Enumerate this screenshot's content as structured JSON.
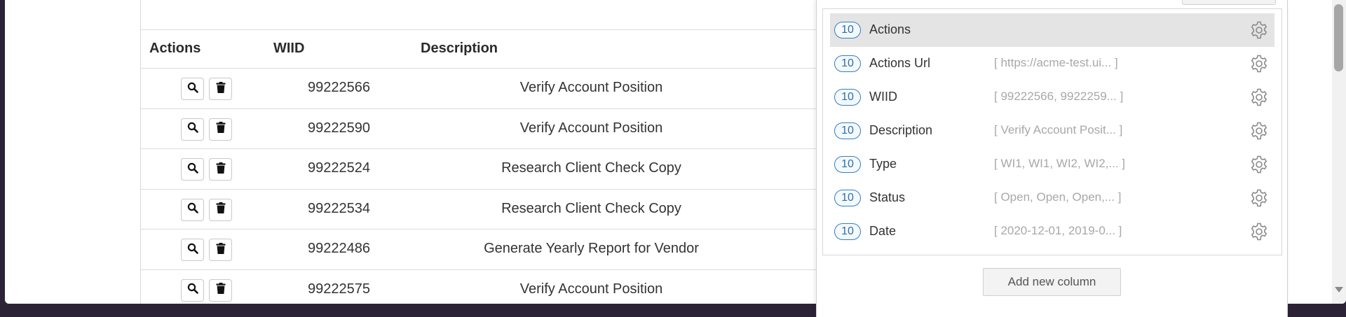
{
  "table": {
    "headers": {
      "actions": "Actions",
      "wiid": "WIID",
      "description": "Description"
    },
    "rows": [
      {
        "wiid": "99222566",
        "description": "Verify Account Position"
      },
      {
        "wiid": "99222590",
        "description": "Verify Account Position"
      },
      {
        "wiid": "99222524",
        "description": "Research Client Check Copy"
      },
      {
        "wiid": "99222534",
        "description": "Research Client Check Copy"
      },
      {
        "wiid": "99222486",
        "description": "Generate Yearly Report for Vendor"
      },
      {
        "wiid": "99222575",
        "description": "Verify Account Position"
      }
    ],
    "row_action_icons": [
      "search-icon",
      "trash-icon"
    ]
  },
  "column_panel": {
    "columns": [
      {
        "count": "10",
        "name": "Actions",
        "preview": ""
      },
      {
        "count": "10",
        "name": "Actions Url",
        "preview": "[ https://acme-test.ui... ]"
      },
      {
        "count": "10",
        "name": "WIID",
        "preview": "[ 99222566, 9922259... ]"
      },
      {
        "count": "10",
        "name": "Description",
        "preview": "[ Verify Account Posit... ]"
      },
      {
        "count": "10",
        "name": "Type",
        "preview": "[ WI1, WI1, WI2, WI2,... ]"
      },
      {
        "count": "10",
        "name": "Status",
        "preview": "[ Open, Open, Open,... ]"
      },
      {
        "count": "10",
        "name": "Date",
        "preview": "[ 2020-12-01, 2019-0... ]"
      }
    ],
    "active_column": "Actions",
    "add_button_label": "Add new column",
    "column_icon": "gear-icon"
  },
  "colors": {
    "badge_border": "#2f7fc4",
    "active_row": "#e4e4e4",
    "desktop_background": "#2c2336"
  }
}
